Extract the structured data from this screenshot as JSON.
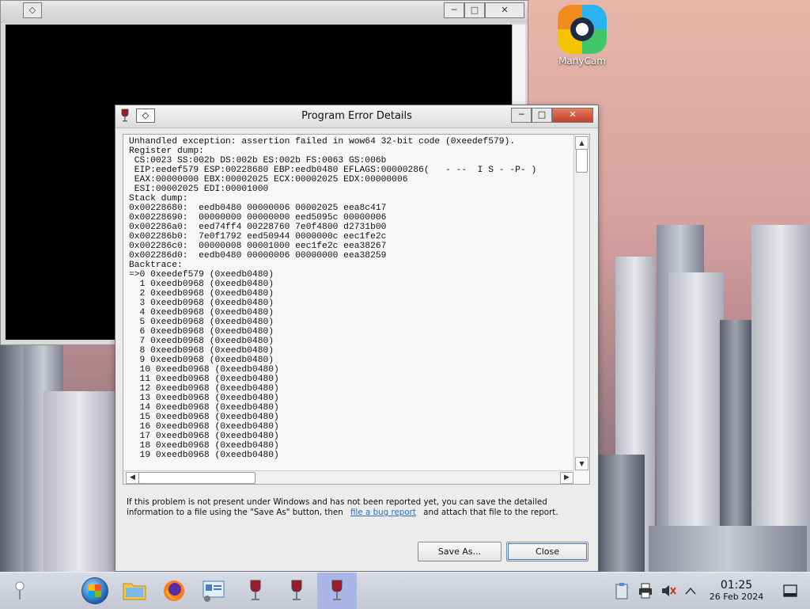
{
  "desktop": {
    "icons": [
      {
        "label": "ManyCam"
      }
    ]
  },
  "background_window": {
    "controls": {
      "minimize": "─",
      "maximize": "□",
      "close": "✕"
    }
  },
  "dialog": {
    "title": "Program Error Details",
    "controls": {
      "minimize": "─",
      "maximize": "□",
      "close": "✕",
      "system_menu": "◇"
    },
    "report_text": "Unhandled exception: assertion failed in wow64 32-bit code (0xeedef579).\nRegister dump:\n CS:0023 SS:002b DS:002b ES:002b FS:0063 GS:006b\n EIP:eedef579 ESP:00228680 EBP:eedb0480 EFLAGS:00000286(   - --  I S - -P- )\n EAX:00000000 EBX:00002025 ECX:00002025 EDX:00000006\n ESI:00002025 EDI:00001000\nStack dump:\n0x00228680:  eedb0480 00000006 00002025 eea8c417\n0x00228690:  00000000 00000000 eed5095c 00000006\n0x002286a0:  eed74ff4 00228760 7e0f4800 d2731b00\n0x002286b0:  7e0f1792 eed50944 0000000c eec1fe2c\n0x002286c0:  00000008 00001000 eec1fe2c eea38267\n0x002286d0:  eedb0480 00000006 00000000 eea38259\nBacktrace:\n=>0 0xeedef579 (0xeedb0480)\n  1 0xeedb0968 (0xeedb0480)\n  2 0xeedb0968 (0xeedb0480)\n  3 0xeedb0968 (0xeedb0480)\n  4 0xeedb0968 (0xeedb0480)\n  5 0xeedb0968 (0xeedb0480)\n  6 0xeedb0968 (0xeedb0480)\n  7 0xeedb0968 (0xeedb0480)\n  8 0xeedb0968 (0xeedb0480)\n  9 0xeedb0968 (0xeedb0480)\n  10 0xeedb0968 (0xeedb0480)\n  11 0xeedb0968 (0xeedb0480)\n  12 0xeedb0968 (0xeedb0480)\n  13 0xeedb0968 (0xeedb0480)\n  14 0xeedb0968 (0xeedb0480)\n  15 0xeedb0968 (0xeedb0480)\n  16 0xeedb0968 (0xeedb0480)\n  17 0xeedb0968 (0xeedb0480)\n  18 0xeedb0968 (0xeedb0480)\n  19 0xeedb0968 (0xeedb0480)",
    "info_text_before": "If this problem is not present under Windows and has not been reported yet, you can save the detailed information to a file using the \"Save As\" button, then",
    "info_link": "file a bug report",
    "info_text_after": "and attach that file to the report.",
    "save_as_label": "Save As...",
    "close_label": "Close"
  },
  "taskbar": {
    "clock_time": "01:25",
    "clock_date": "26 Feb 2024",
    "apps": [
      "start-menu",
      "file-manager",
      "firefox",
      "control-panel",
      "wine-app",
      "wine-app",
      "wine-app"
    ]
  }
}
